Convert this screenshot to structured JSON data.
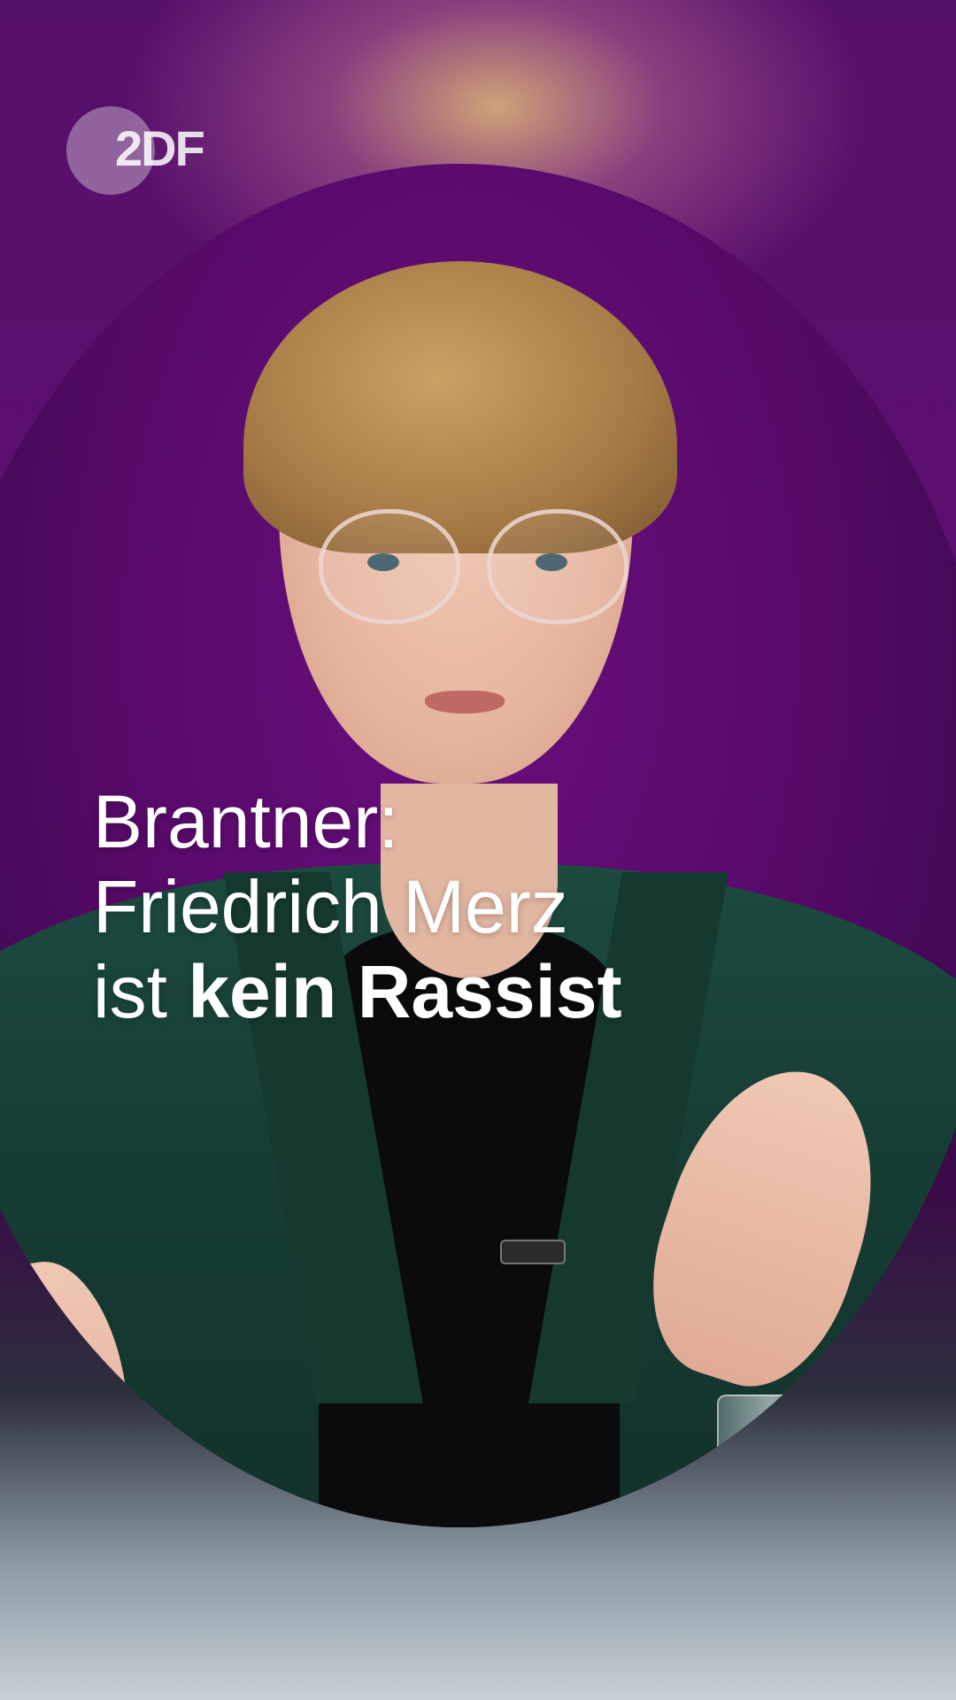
{
  "logo": {
    "text": "2DF",
    "icon": "zdf-logo-icon"
  },
  "headline": {
    "line1": "Brantner:",
    "line2": "Friedrich Merz",
    "line3_regular": "ist ",
    "line3_bold": "kein Rassist"
  },
  "colors": {
    "background_purple": "#5d0f70",
    "jacket_green": "#1c4a40",
    "text": "#ffffff"
  }
}
